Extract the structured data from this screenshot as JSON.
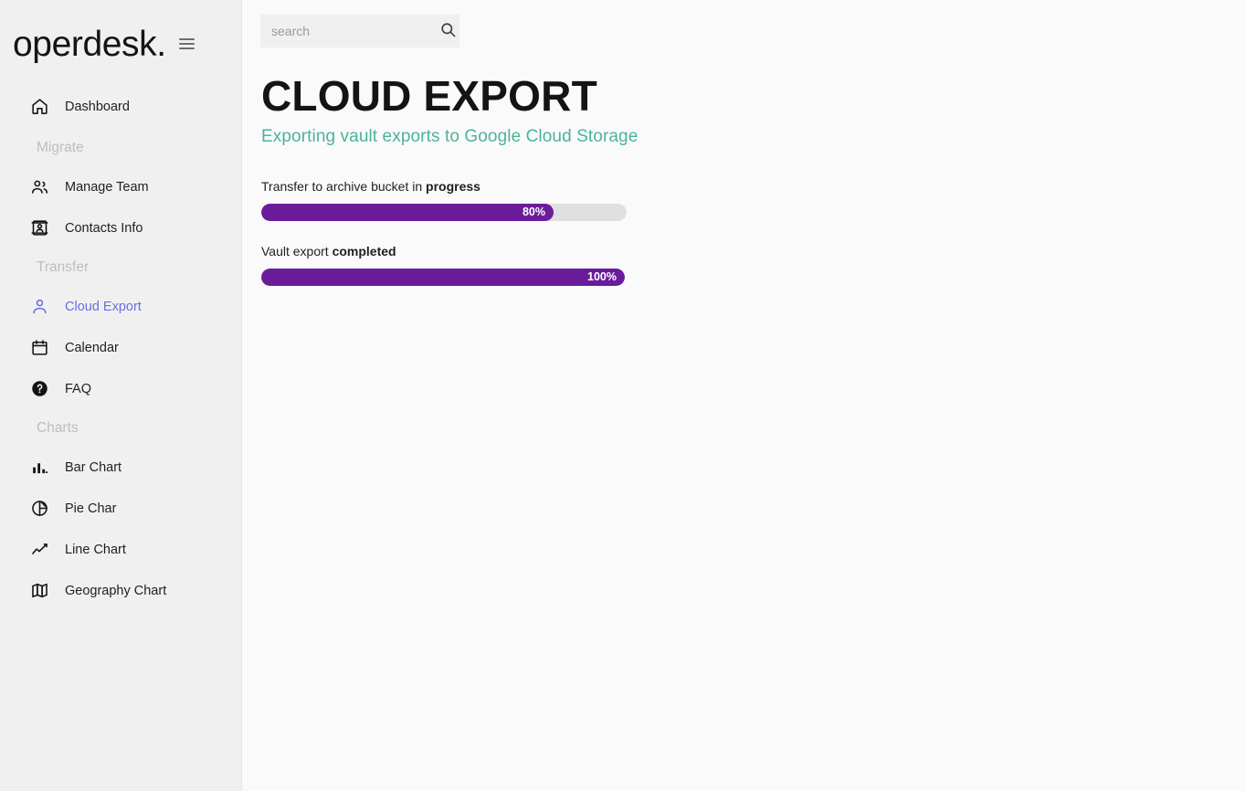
{
  "brand": {
    "name": "operdesk.",
    "menu_icon": "hamburger-icon"
  },
  "search": {
    "placeholder": "search",
    "value": "",
    "icon": "search-icon"
  },
  "sidebar": {
    "groups": [
      {
        "heading": null,
        "items": [
          {
            "label": "Dashboard",
            "icon": "home-icon",
            "active": false
          }
        ]
      },
      {
        "heading": "Migrate",
        "items": [
          {
            "label": "Manage Team",
            "icon": "people-icon",
            "active": false
          },
          {
            "label": "Contacts Info",
            "icon": "contact-card-icon",
            "active": false
          }
        ]
      },
      {
        "heading": "Transfer",
        "items": [
          {
            "label": "Cloud Export",
            "icon": "person-icon",
            "active": true
          },
          {
            "label": "Calendar",
            "icon": "calendar-icon",
            "active": false
          },
          {
            "label": "FAQ",
            "icon": "help-circle-icon",
            "active": false
          }
        ]
      },
      {
        "heading": "Charts",
        "items": [
          {
            "label": "Bar Chart",
            "icon": "bar-chart-icon",
            "active": false
          },
          {
            "label": "Pie Char",
            "icon": "pie-chart-icon",
            "active": false
          },
          {
            "label": "Line Chart",
            "icon": "line-chart-icon",
            "active": false
          },
          {
            "label": "Geography Chart",
            "icon": "map-icon",
            "active": false
          }
        ]
      }
    ]
  },
  "page": {
    "title": "CLOUD EXPORT",
    "subtitle": "Exporting vault exports to Google Cloud Storage"
  },
  "progress_items": [
    {
      "label_prefix": "Transfer to archive bucket in ",
      "label_strong": "progress",
      "percent": 80,
      "value_text": "80%"
    },
    {
      "label_prefix": "Vault export ",
      "label_strong": "completed",
      "percent": 100,
      "value_text": "100%"
    }
  ],
  "colors": {
    "accent_purple": "#6a1b9a",
    "accent_teal": "#4cb39b",
    "active_nav": "#6870e0",
    "sidebar_bg": "#f0f0f0",
    "main_bg": "#fafafa",
    "track": "#e0e0e0"
  }
}
